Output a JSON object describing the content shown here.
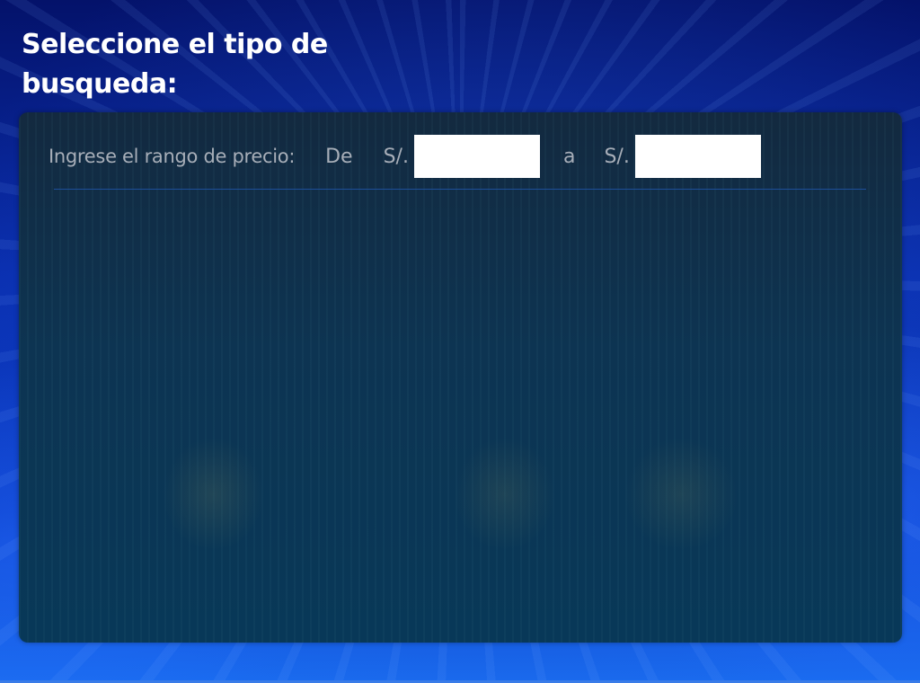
{
  "page": {
    "title": "Seleccione el tipo de busqueda:"
  },
  "price_filter": {
    "label": "Ingrese el rango de precio:",
    "from_label": "De",
    "currency_symbol": "S/.",
    "to_label": "a",
    "min_value": "",
    "max_value": ""
  },
  "colors": {
    "background": "#0b3ec9",
    "panel": "#0d3452",
    "label_text": "#a7aeb8",
    "title_text": "#ffffff"
  }
}
